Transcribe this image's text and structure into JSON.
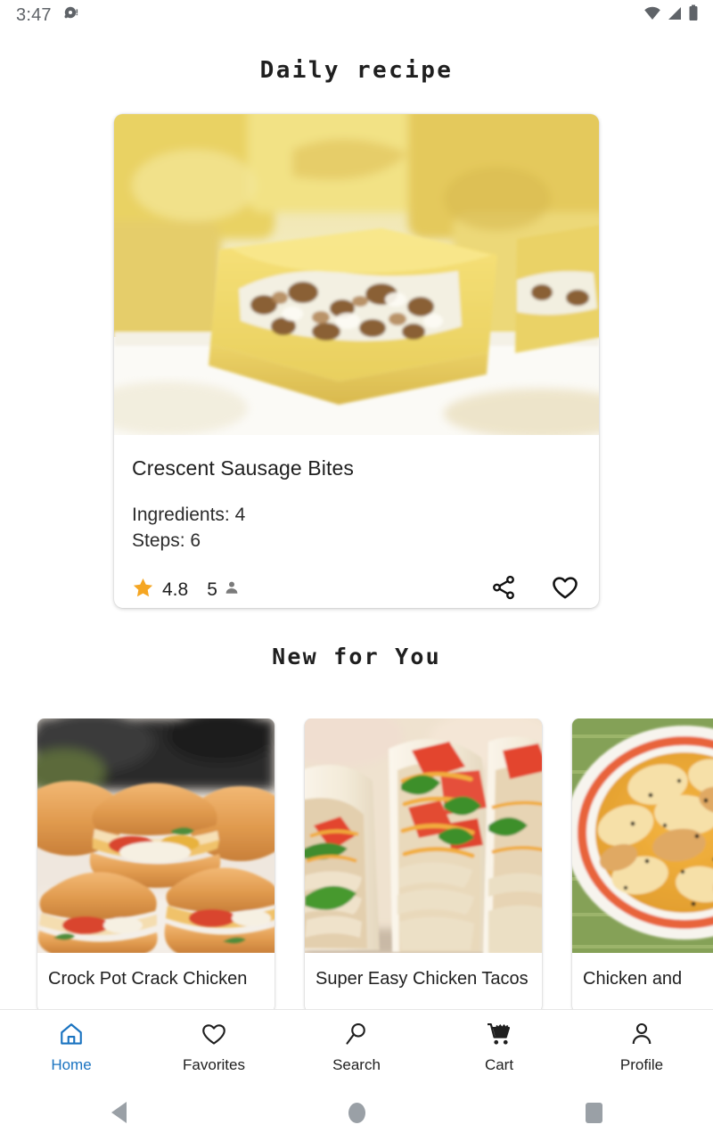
{
  "status_bar": {
    "time": "3:47",
    "notification_icon": "record-notification-icon",
    "wifi_icon": "wifi-icon",
    "signal_icon": "cellular-signal-icon",
    "battery_icon": "battery-full-icon"
  },
  "header": {
    "title": "Daily recipe"
  },
  "daily_recipe": {
    "image_alt": "Crescent sausage bite squares on a white plate",
    "title": "Crescent Sausage Bites",
    "ingredients_label": "Ingredients: 4",
    "steps_label": "Steps: 6",
    "rating": "4.8",
    "servings": "5",
    "star_icon": "star-icon",
    "person_icon": "person-icon",
    "share_icon": "share-icon",
    "favorite_icon": "heart-outline-icon",
    "star_color": "#F5A623"
  },
  "new_for_you": {
    "title": "New for You",
    "cards": [
      {
        "title": "Crock Pot Crack Chicken",
        "image_alt": "Stack of cheesy bacon chicken sliders on golden buns"
      },
      {
        "title": "Super Easy Chicken Tacos",
        "image_alt": "Soft tacos with shredded chicken, tomato, cheese and cilantro"
      },
      {
        "title": "Chicken and",
        "image_alt": "Bowl of chicken and dumplings with orange rim"
      }
    ]
  },
  "bottom_nav": {
    "active_color": "#1a73c0",
    "items": [
      {
        "label": "Home",
        "icon": "home-icon",
        "active": true
      },
      {
        "label": "Favorites",
        "icon": "heart-outline-icon",
        "active": false
      },
      {
        "label": "Search",
        "icon": "search-icon",
        "active": false
      },
      {
        "label": "Cart",
        "icon": "shopping-cart-icon",
        "active": false
      },
      {
        "label": "Profile",
        "icon": "person-icon",
        "active": false
      }
    ]
  },
  "system_nav": {
    "back": "back-button",
    "home": "home-button",
    "recents": "recents-button"
  }
}
